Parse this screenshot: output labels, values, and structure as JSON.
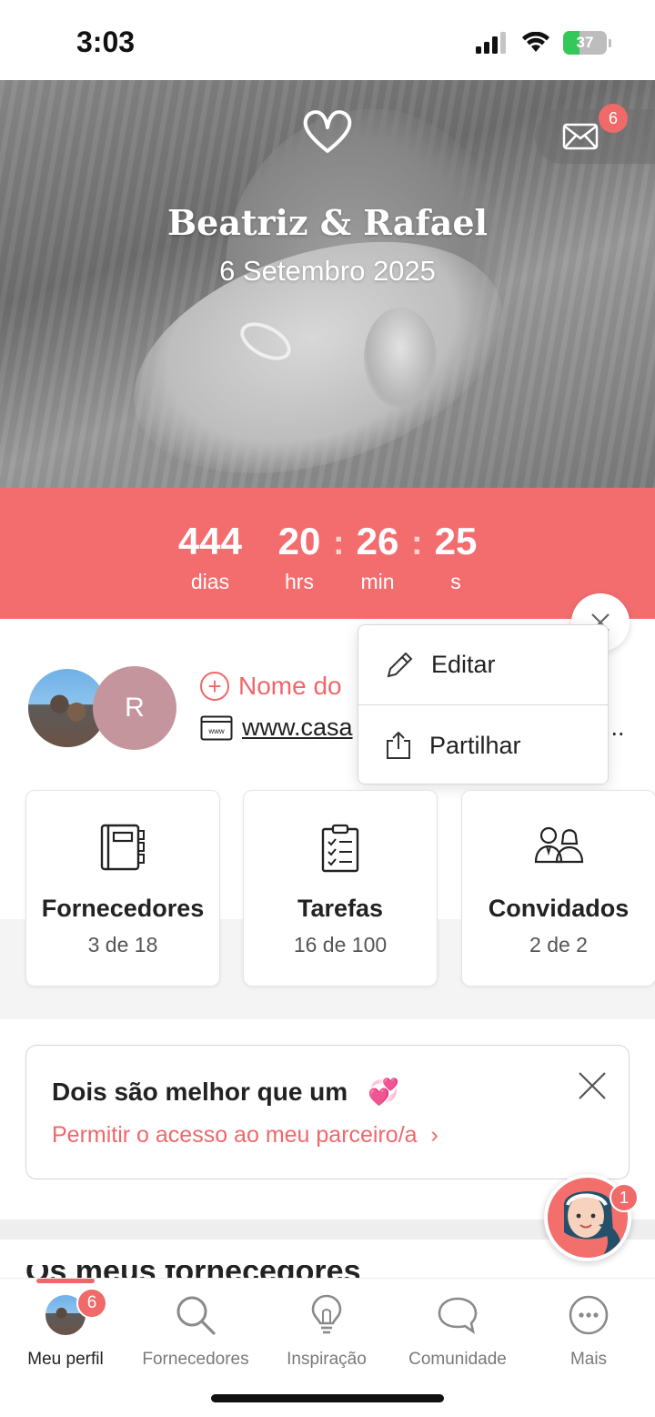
{
  "status_bar": {
    "time": "3:03",
    "battery": "37"
  },
  "hero": {
    "names": "Beatriz & Rafael",
    "date": "6 Setembro 2025",
    "mail_badge": "6"
  },
  "countdown": {
    "days": "444",
    "days_label": "dias",
    "hours": "20",
    "hours_label": "hrs",
    "minutes": "26",
    "minutes_label": "min",
    "seconds": "25",
    "seconds_label": "s",
    "separator": ":"
  },
  "profile": {
    "partner_initial": "R",
    "add_name_label": "Nome do",
    "website": "www.casa",
    "website_ellipsis": "..."
  },
  "popup_menu": {
    "items": [
      {
        "label": "Editar",
        "icon": "pencil-icon"
      },
      {
        "label": "Partilhar",
        "icon": "share-icon"
      }
    ]
  },
  "cards": [
    {
      "title": "Fornecedores",
      "count": "3 de 18",
      "icon": "notebook-icon"
    },
    {
      "title": "Tarefas",
      "count": "16 de 100",
      "icon": "checklist-icon"
    },
    {
      "title": "Convidados",
      "count": "2 de 2",
      "icon": "guests-icon"
    }
  ],
  "banner": {
    "title": "Dois são melhor que um",
    "emoji": "💞",
    "link": "Permitir o acesso ao meu parceiro/a",
    "link_arrow": "›"
  },
  "section_heading": "Os meus fornecedores",
  "assistant": {
    "badge": "1"
  },
  "bottom_nav": {
    "items": [
      {
        "label": "Meu perfil",
        "icon": "avatar-icon",
        "badge": "6",
        "active": true
      },
      {
        "label": "Fornecedores",
        "icon": "search-icon"
      },
      {
        "label": "Inspiração",
        "icon": "lightbulb-icon"
      },
      {
        "label": "Comunidade",
        "icon": "chat-bubble-icon"
      },
      {
        "label": "Mais",
        "icon": "more-icon"
      }
    ]
  },
  "colors": {
    "accent": "#f36d6f",
    "link": "#f0676a",
    "badge": "#f06a6a"
  }
}
